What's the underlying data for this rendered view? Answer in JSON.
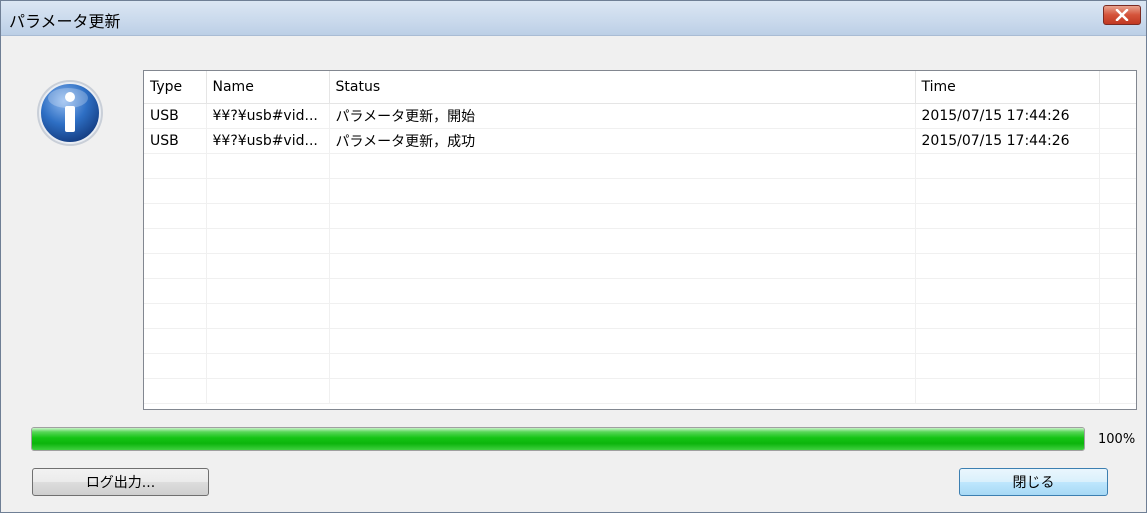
{
  "window": {
    "title": "パラメータ更新"
  },
  "table": {
    "columns": [
      "Type",
      "Name",
      "Status",
      "Time"
    ],
    "rows": [
      {
        "type": "USB",
        "name": "¥¥?¥usb#vid...",
        "status": "パラメータ更新，開始",
        "time": "2015/07/15 17:44:26"
      },
      {
        "type": "USB",
        "name": "¥¥?¥usb#vid...",
        "status": "パラメータ更新，成功",
        "time": "2015/07/15 17:44:26"
      }
    ]
  },
  "progress": {
    "value": 1.0,
    "label": "100%"
  },
  "buttons": {
    "log_export": "ログ出力...",
    "close": "閉じる"
  },
  "colors": {
    "progress_fill": "#14c414",
    "close_button": "#c13822",
    "info_icon": "#1f5fb0"
  },
  "icons": {
    "info": "info-icon",
    "close": "close-icon"
  }
}
